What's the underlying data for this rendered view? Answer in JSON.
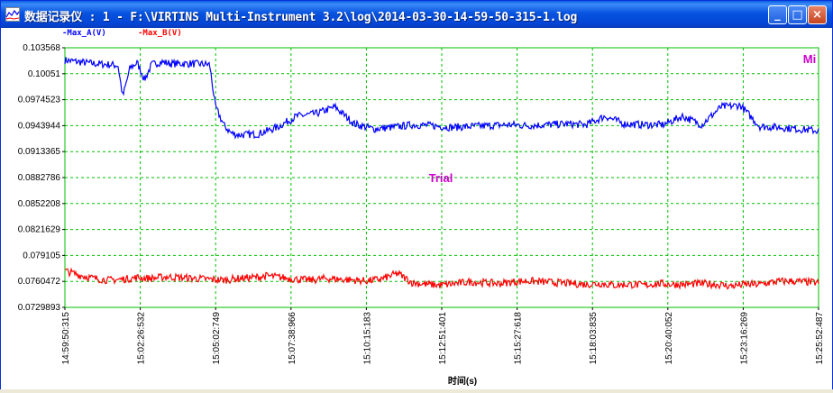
{
  "window": {
    "title": "数据记录仪 : 1 - F:\\VIRTINS Multi-Instrument 3.2\\log\\2014-03-30-14-59-50-315-1.log",
    "buttons": [
      "_",
      "□",
      "×"
    ]
  },
  "colors": {
    "series_a": "#0000ff",
    "series_b": "#ff0000",
    "grid": "#00c000",
    "watermark": "#cc00cc",
    "mi_logo": "#cc00cc"
  },
  "legend": [
    "-Max_A(V)",
    "-Max_B(V)"
  ],
  "watermark": "Trial",
  "logo": "Mi",
  "chart_data": {
    "type": "line",
    "xlabel": "时间(s)",
    "ylabel": "",
    "ylim": [
      0.0729893,
      0.103568
    ],
    "y_ticks": [
      "0.103568",
      "0.10051",
      "0.0974523",
      "0.0943944",
      "0.0913365",
      "0.0882786",
      "0.0852208",
      "0.0821629",
      "0.079105",
      "0.0760472",
      "0.0729893"
    ],
    "x_ticks": [
      "14:59:50:315",
      "15:02:26:532",
      "15:05:02:749",
      "15:07:38:966",
      "15:10:15:183",
      "15:12:51:401",
      "15:15:27:618",
      "15:18:03:835",
      "15:20:40:052",
      "15:23:16:269",
      "15:25:52:487"
    ],
    "series": [
      {
        "name": "Max_A(V)",
        "x_seconds": [
          0,
          30,
          60,
          90,
          110,
          120,
          135,
          150,
          165,
          180,
          200,
          220,
          260,
          300,
          312,
          330,
          345,
          360,
          400,
          440,
          480,
          520,
          560,
          600,
          640,
          680,
          720,
          760,
          800,
          840,
          880,
          920,
          960,
          1000,
          1040,
          1080,
          1120,
          1160,
          1200,
          1240,
          1280,
          1320,
          1360,
          1400,
          1440,
          1480,
          1520,
          1560
        ],
        "values": [
          0.1021,
          0.1019,
          0.1017,
          0.1016,
          0.1015,
          0.0978,
          0.1012,
          0.1018,
          0.0998,
          0.1016,
          0.1019,
          0.1017,
          0.1017,
          0.1016,
          0.0966,
          0.0944,
          0.0935,
          0.0933,
          0.0934,
          0.0942,
          0.0955,
          0.0958,
          0.0966,
          0.0946,
          0.094,
          0.0942,
          0.0945,
          0.0944,
          0.0942,
          0.0943,
          0.0944,
          0.0945,
          0.0944,
          0.0945,
          0.0946,
          0.0945,
          0.0955,
          0.0946,
          0.0945,
          0.0945,
          0.0955,
          0.0945,
          0.0966,
          0.0968,
          0.0943,
          0.0942,
          0.094,
          0.0938
        ]
      },
      {
        "name": "Max_B(V)",
        "x_seconds": [
          0,
          30,
          60,
          90,
          120,
          150,
          180,
          210,
          240,
          270,
          300,
          330,
          360,
          390,
          420,
          450,
          480,
          510,
          540,
          570,
          600,
          630,
          660,
          690,
          720,
          750,
          780,
          810,
          840,
          870,
          900,
          930,
          960,
          990,
          1020,
          1050,
          1080,
          1110,
          1140,
          1170,
          1200,
          1230,
          1260,
          1290,
          1320,
          1350,
          1380,
          1410,
          1440,
          1470,
          1500,
          1530,
          1560
        ],
        "values": [
          0.0773,
          0.0768,
          0.0764,
          0.0762,
          0.0763,
          0.0765,
          0.0764,
          0.0766,
          0.0765,
          0.0764,
          0.0763,
          0.0762,
          0.0764,
          0.0765,
          0.0767,
          0.0765,
          0.0763,
          0.0762,
          0.0764,
          0.0763,
          0.0762,
          0.0761,
          0.0764,
          0.077,
          0.0759,
          0.0757,
          0.0756,
          0.0758,
          0.076,
          0.0759,
          0.0758,
          0.076,
          0.0761,
          0.076,
          0.0759,
          0.0758,
          0.0757,
          0.0758,
          0.0756,
          0.0757,
          0.0756,
          0.0758,
          0.0757,
          0.0757,
          0.0758,
          0.0757,
          0.0755,
          0.0757,
          0.0757,
          0.076,
          0.0761,
          0.076,
          0.0759
        ]
      }
    ],
    "x_range_seconds": [
      0,
      1562.172
    ],
    "grid": true,
    "legend_position": "top-left"
  }
}
